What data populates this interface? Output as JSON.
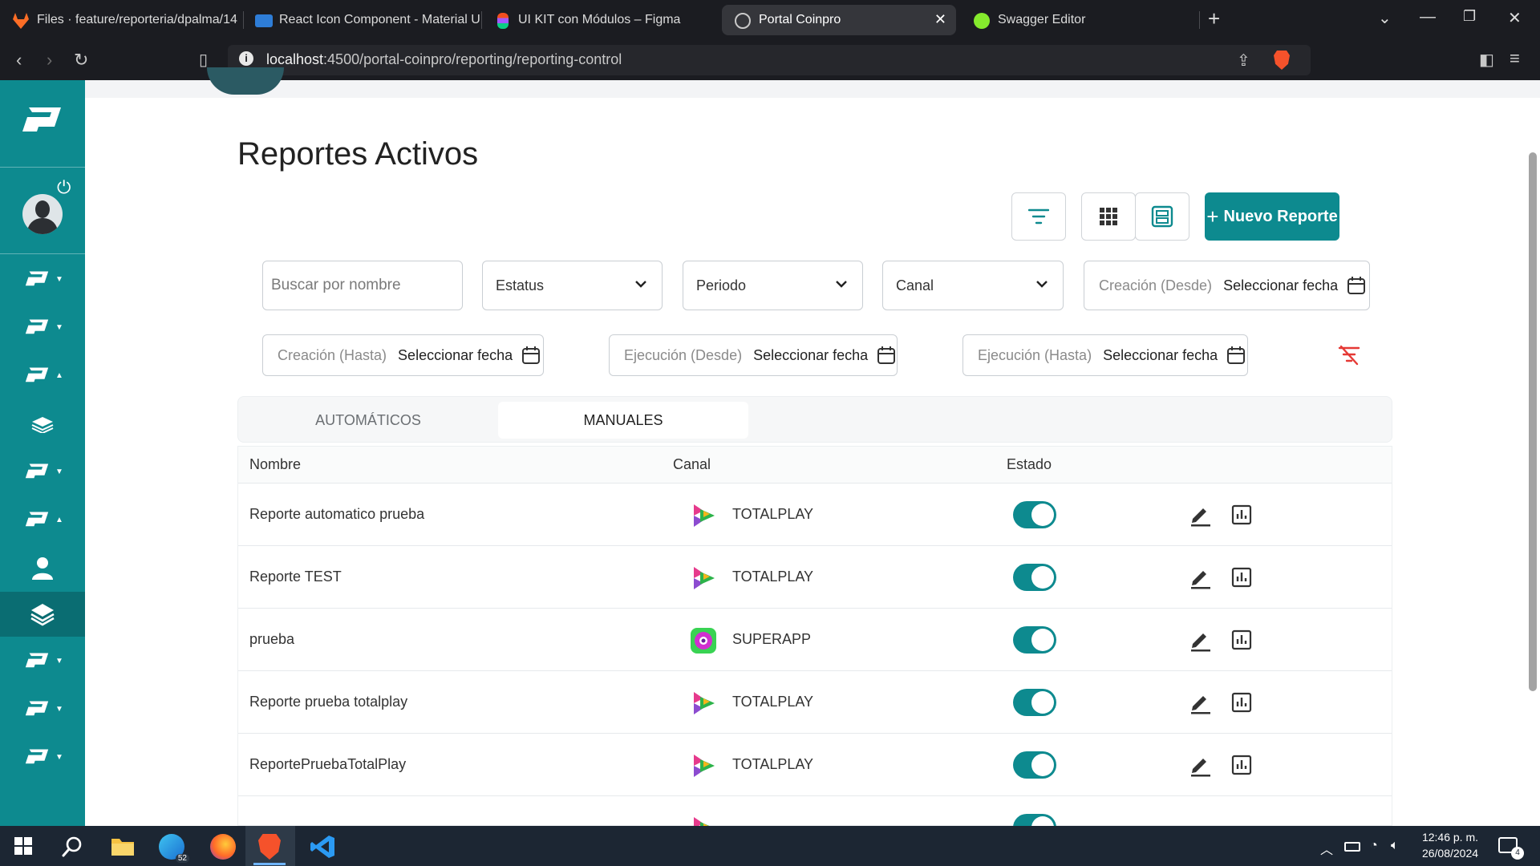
{
  "browser": {
    "tabs": [
      {
        "label": "Files · feature/reporteria/dpalma/14",
        "icon": "gitlab-icon",
        "color": "#fc6d26"
      },
      {
        "label": "React Icon Component - Material UI",
        "icon": "mui-icon",
        "color": "#2e7dd7"
      },
      {
        "label": "UI KIT con Módulos – Figma",
        "icon": "figma-icon",
        "color": "#f24e1e"
      },
      {
        "label": "Portal Coinpro",
        "icon": "globe-icon",
        "color": "#9aa0a6"
      },
      {
        "label": "Swagger Editor",
        "icon": "swagger-icon",
        "color": "#85ea2d"
      }
    ],
    "url_host": "localhost",
    "url_path": ":4500/portal-coinpro/reporting/reporting-control"
  },
  "page": {
    "title": "Reportes Activos",
    "new_report_label": "Nuevo Reporte",
    "filters": {
      "search_placeholder": "Buscar por nombre",
      "status": "Estatus",
      "period": "Periodo",
      "channel": "Canal",
      "created_from_label": "Creación (Desde)",
      "created_to_label": "Creación (Hasta)",
      "exec_from_label": "Ejecución (Desde)",
      "exec_to_label": "Ejecución (Hasta)",
      "date_value": "Seleccionar fecha"
    },
    "tabs": {
      "automatic": "AUTOMÁTICOS",
      "manual": "MANUALES"
    },
    "table": {
      "headers": {
        "name": "Nombre",
        "channel": "Canal",
        "status": "Estado"
      },
      "rows": [
        {
          "name": "Reporte automatico prueba",
          "channel": "TOTALPLAY",
          "active": true
        },
        {
          "name": "Reporte TEST",
          "channel": "TOTALPLAY",
          "active": true
        },
        {
          "name": "prueba",
          "channel": "SUPERAPP",
          "active": true
        },
        {
          "name": "Reporte prueba totalplay",
          "channel": "TOTALPLAY",
          "active": true
        },
        {
          "name": "ReportePruebaTotalPlay",
          "channel": "TOTALPLAY",
          "active": true
        }
      ]
    }
  },
  "colors": {
    "accent": "#0d8a8f",
    "danger": "#e53935"
  },
  "taskbar": {
    "time": "12:46 p. m.",
    "date": "26/08/2024",
    "edge_badge": "52",
    "notif_badge": "4"
  }
}
